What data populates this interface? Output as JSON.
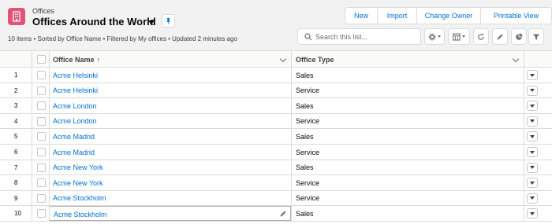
{
  "header": {
    "object_label": "Offices",
    "list_title": "Offices Around the World",
    "meta": "10 items • Sorted by Office Name • Filtered by My offices • Updated 2 minutes ago"
  },
  "actions": {
    "new_label": "New",
    "import_label": "Import",
    "change_owner_label": "Change Owner",
    "printable_view_label": "Printable View"
  },
  "search": {
    "placeholder": "Search this list...",
    "value": ""
  },
  "toolbar": {
    "icons": [
      "gear-icon",
      "table-icon",
      "refresh-icon",
      "pencil-icon",
      "chart-icon",
      "filter-icon"
    ]
  },
  "table": {
    "columns": {
      "name": "Office Name",
      "sort_indicator": "↑",
      "type": "Office Type"
    },
    "rows": [
      {
        "num": "1",
        "name": "Acme Helsinki",
        "type": "Sales"
      },
      {
        "num": "2",
        "name": "Acme Helsinki",
        "type": "Service"
      },
      {
        "num": "3",
        "name": "Acme London",
        "type": "Sales"
      },
      {
        "num": "4",
        "name": "Acme London",
        "type": "Service"
      },
      {
        "num": "5",
        "name": "Acme Madrid",
        "type": "Sales"
      },
      {
        "num": "6",
        "name": "Acme Madrid",
        "type": "Service"
      },
      {
        "num": "7",
        "name": "Acme New York",
        "type": "Sales"
      },
      {
        "num": "8",
        "name": "Acme New York",
        "type": "Service"
      },
      {
        "num": "9",
        "name": "Acme Stockholm",
        "type": "Service"
      },
      {
        "num": "10",
        "name": "Acme Stockholm",
        "type": "Sales"
      }
    ]
  },
  "colors": {
    "brand_icon": "#e3527a",
    "link": "#0070d2",
    "border": "#dddbda"
  }
}
